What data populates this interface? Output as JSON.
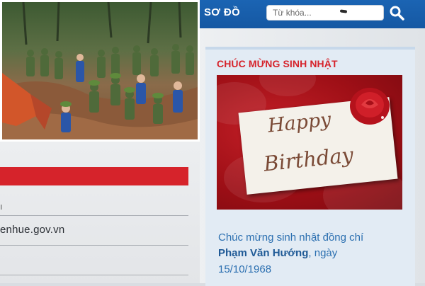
{
  "nav": {
    "section_label": "SƠ ĐỒ",
    "search_placeholder": "Từ khóa..."
  },
  "left_page": {
    "site_url": "enhue.gov.vn"
  },
  "widget": {
    "title": "CHÚC MỪNG SINH NHẬT",
    "card": {
      "happy": "Happy",
      "birthday": "Birthday"
    },
    "message_prefix": "Chúc mừng sinh nhật đồng chí",
    "person_name": "Phạm Văn Hướng",
    "message_suffix": ", ngày",
    "date": "15/10/1968"
  },
  "colors": {
    "nav_blue": "#1b64b3",
    "accent_red": "#d6232b",
    "link_blue": "#2b6fb0",
    "widget_bg": "#e2ebf4"
  },
  "icons": [
    "search-icon",
    "rose-image",
    "rescue-photo"
  ]
}
